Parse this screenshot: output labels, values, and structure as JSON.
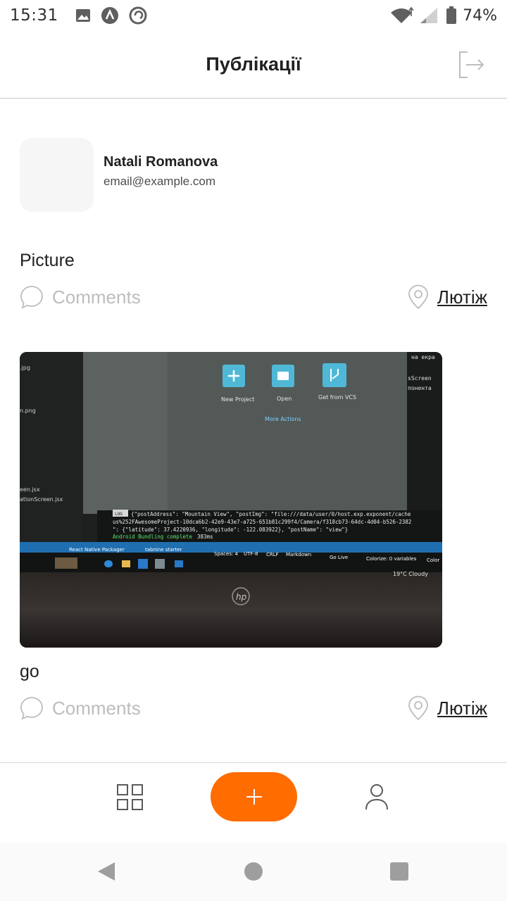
{
  "status_bar": {
    "time": "15:31",
    "battery": "74%",
    "icons": [
      "image-icon",
      "app-icon",
      "sync-icon",
      "wifi-icon",
      "signal-icon",
      "battery-icon"
    ]
  },
  "header": {
    "title": "Публікації",
    "logout_icon": "logout-icon"
  },
  "profile": {
    "name": "Natali Romanova",
    "email": "email@example.com"
  },
  "posts": [
    {
      "title": "Picture",
      "comments_label": "Comments",
      "location_label": "Лютіж",
      "has_photo": false
    },
    {
      "title": "go",
      "comments_label": "Comments",
      "location_label": "Лютіж",
      "has_photo": true
    }
  ],
  "photo": {
    "actions": [
      "New Project",
      "Open",
      "Get from VCS"
    ],
    "more_actions": "More Actions",
    "log_lines": [
      "{\"postAddress\": \"Mountain View\", \"postImg\": \"file:///data/user/0/host.exp.exponent/cache",
      "us%252FAwesomeProject-10dca6b2-42e9-43e7-a725-651b81c299f4/Camera/f318cb73-64dc-4d04-b526-2382",
      "\": {\"latitude\": 37.4220936, \"longitude\": -122.083922}, \"postName\": \"view\"}"
    ],
    "bundling": "Android Bundling complete",
    "bundling_time": "383ms",
    "files": [
      ".jpg",
      "n.png",
      "een.jsx",
      "ationScreen.jsx"
    ],
    "right_text": [
      "на екра",
      "sScreen",
      "понента"
    ],
    "status_items": [
      "React Native Packager",
      "tabnine starter",
      "Spaces: 4",
      "UTF-8",
      "CRLF",
      "Markdown",
      "Go Live",
      "Colorize: 0 variables",
      "Color"
    ],
    "weather": "19°C Cloudy",
    "log_tag": "LOG"
  },
  "tab_bar": {
    "grid_icon": "grid-icon",
    "add_icon": "plus-icon",
    "user_icon": "user-icon",
    "accent": "#FF6C00"
  },
  "system_nav": {
    "back_icon": "back-icon",
    "home_icon": "home-icon",
    "recents_icon": "recents-icon"
  }
}
